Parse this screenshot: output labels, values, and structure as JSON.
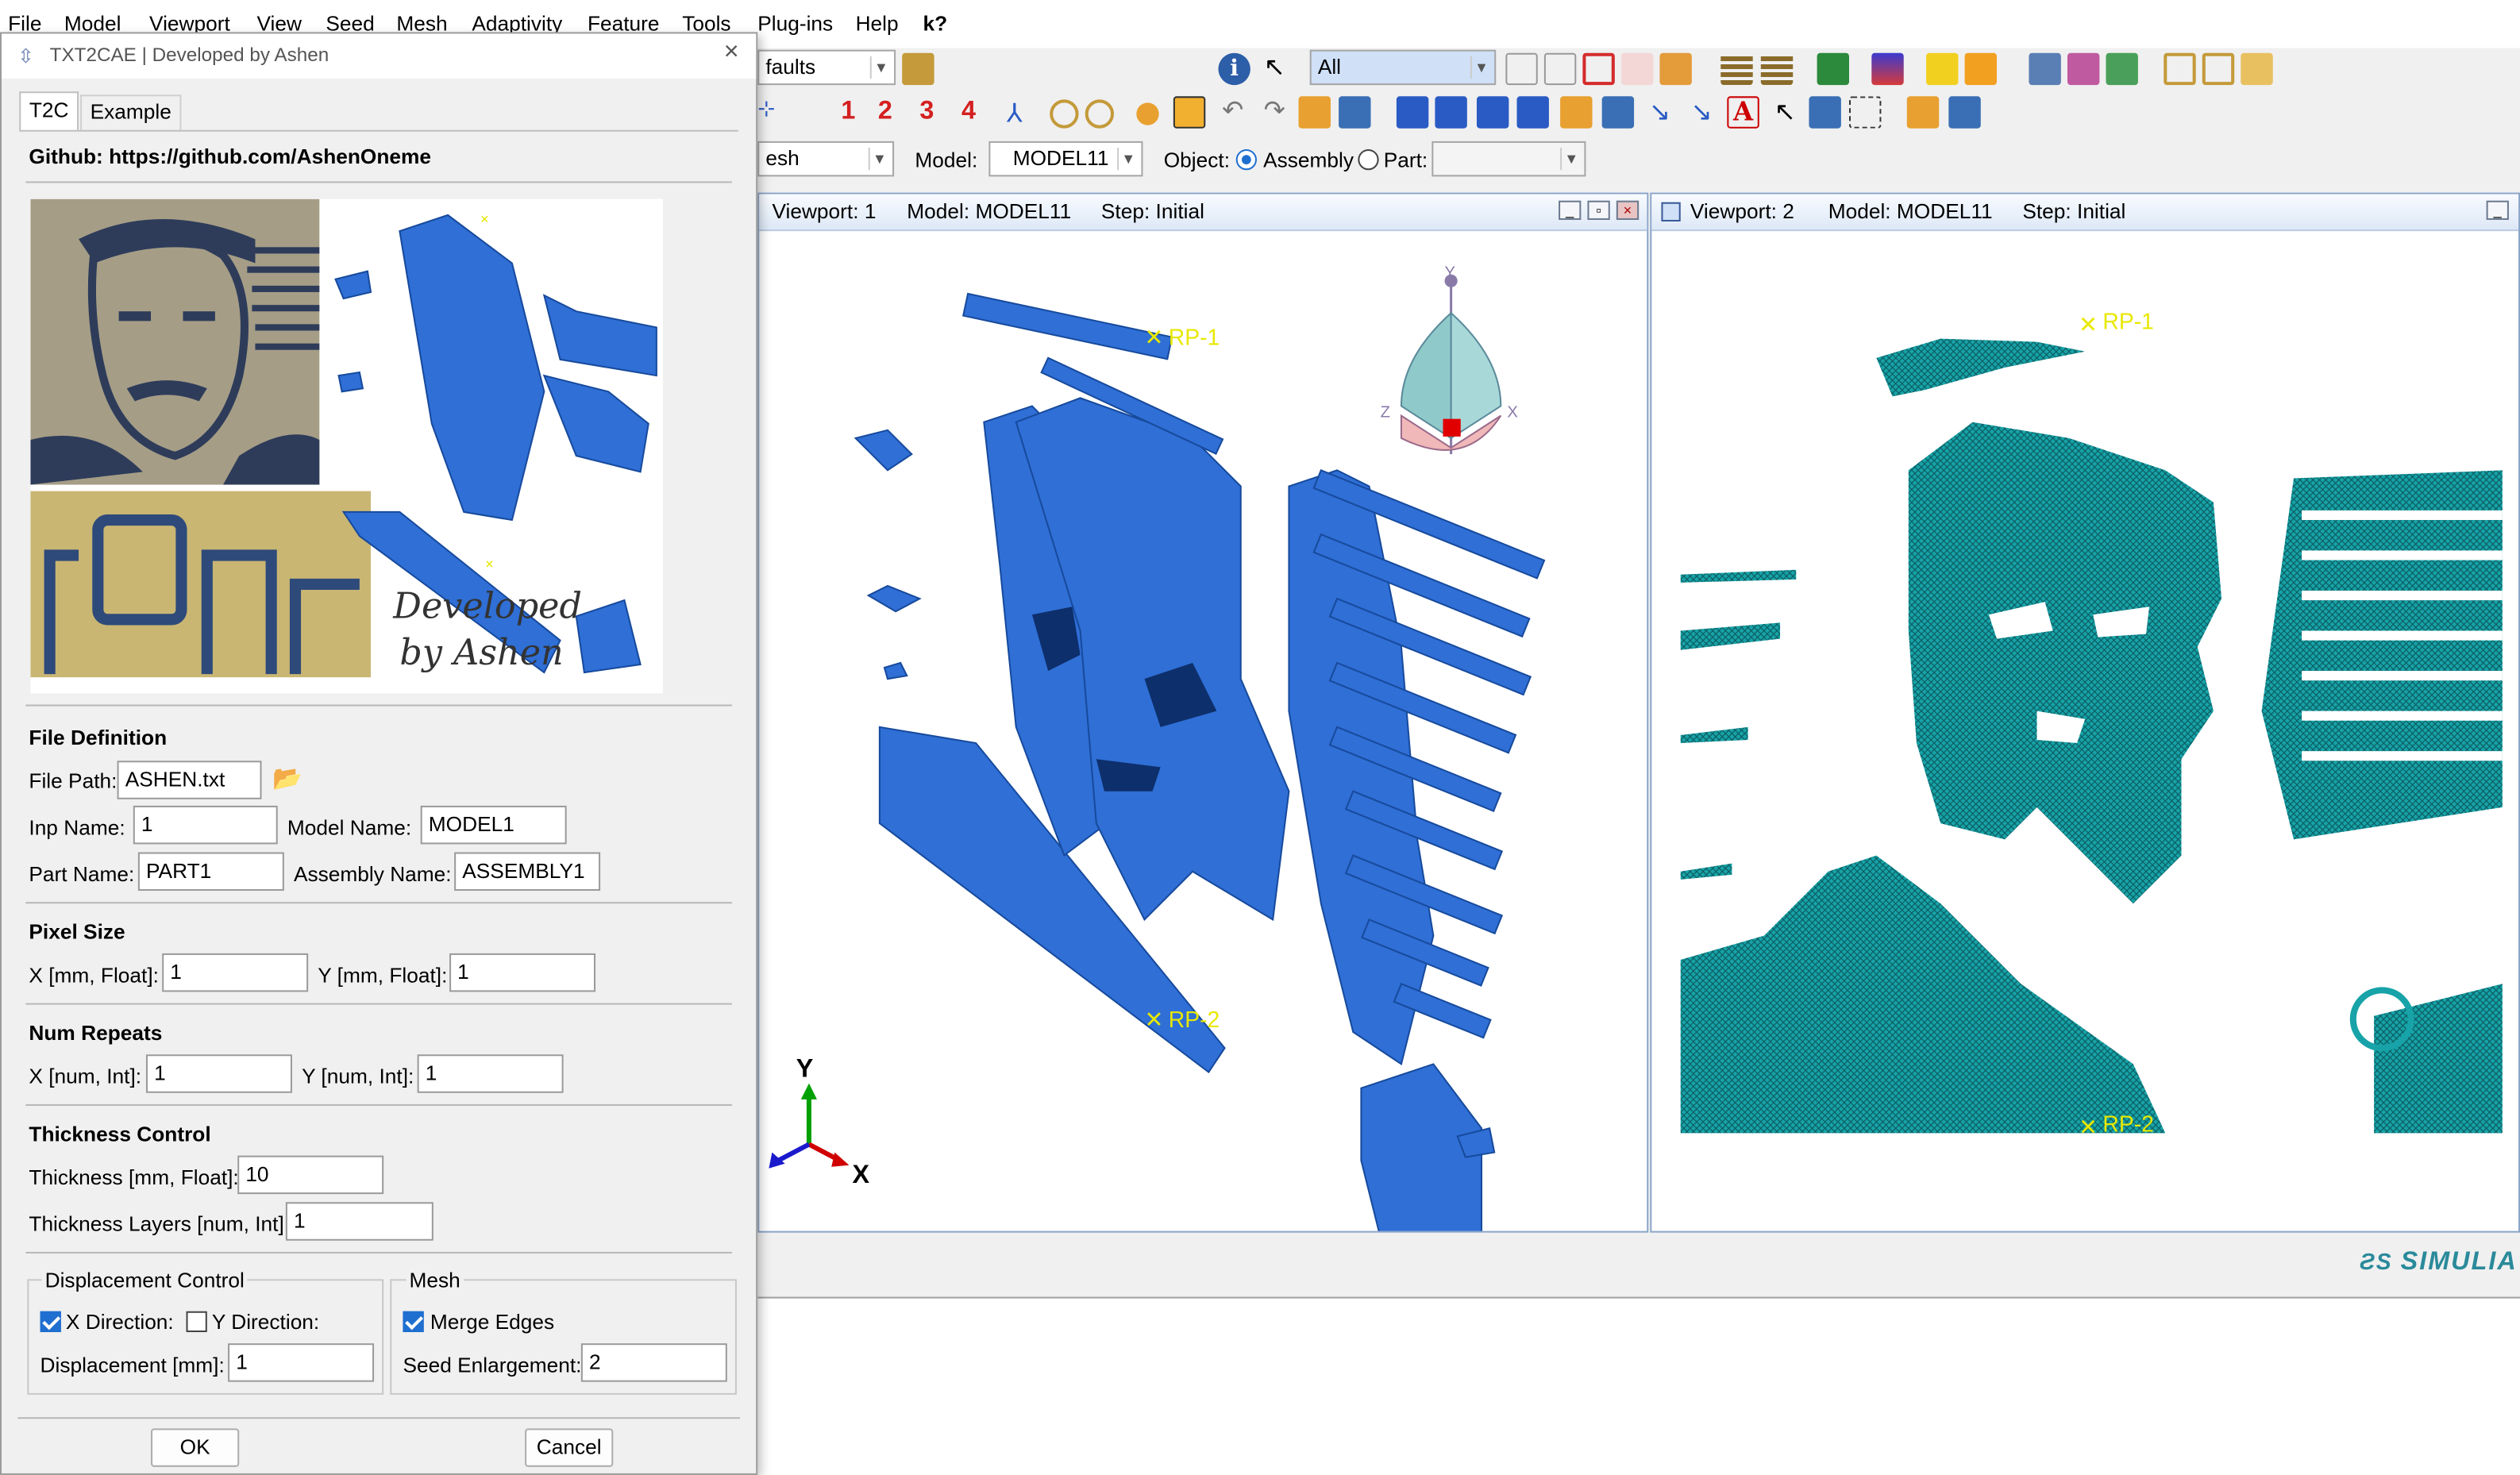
{
  "menubar": {
    "items": [
      "File",
      "Model",
      "Viewport",
      "View",
      "Seed",
      "Mesh",
      "Adaptivity",
      "Feature",
      "Tools",
      "Plug-ins",
      "Help"
    ],
    "help_cursor": "k?"
  },
  "toolbar": {
    "defaults_combo": "faults",
    "selection_combo": "All",
    "view_numbers": [
      "1",
      "2",
      "3",
      "4"
    ],
    "module_combo": "esh",
    "model_label": "Model:",
    "model_combo": "MODEL11",
    "object_label": "Object:",
    "assembly_label": "Assembly",
    "part_label": "Part:"
  },
  "viewport1": {
    "title": "Viewport: 1",
    "model": "Model: MODEL11",
    "step": "Step: Initial",
    "rp1": "RP-1",
    "rp2": "RP-2",
    "triad_y": "Y",
    "triad_x": "X",
    "view_y": "Y",
    "view_z": "Z",
    "view_x": "X"
  },
  "viewport2": {
    "title": "Viewport: 2",
    "model": "Model: MODEL11",
    "step": "Step: Initial",
    "rp1": "RP-1",
    "rp2": "RP-2"
  },
  "brand": "SIMULIA",
  "dialog": {
    "title": "TXT2CAE | Developed by Ashen",
    "tabs": [
      "T2C",
      "Example"
    ],
    "github": "Github: https://github.com/AshenOneme",
    "banner_line1": "Developed",
    "banner_line2": "by Ashen",
    "file_definition": {
      "title": "File Definition",
      "file_path_label": "File Path:",
      "file_path": "ASHEN.txt",
      "inp_name_label": "Inp Name:",
      "inp_name": "1",
      "model_name_label": "Model Name:",
      "model_name": "MODEL1",
      "part_name_label": "Part Name:",
      "part_name": "PART1",
      "assembly_name_label": "Assembly Name:",
      "assembly_name": "ASSEMBLY1"
    },
    "pixel_size": {
      "title": "Pixel Size",
      "x_label": "X [mm, Float]:",
      "x": "1",
      "y_label": "Y [mm, Float]:",
      "y": "1"
    },
    "num_repeats": {
      "title": "Num Repeats",
      "x_label": "X [num, Int]:",
      "x": "1",
      "y_label": "Y [num, Int]:",
      "y": "1"
    },
    "thickness": {
      "title": "Thickness Control",
      "thickness_label": "Thickness [mm, Float]:",
      "thickness": "10",
      "layers_label": "Thickness Layers [num, Int]:",
      "layers": "1"
    },
    "displacement": {
      "title": "Displacement Control",
      "x_dir_label": "X Direction:",
      "x_dir_checked": true,
      "y_dir_label": "Y Direction:",
      "y_dir_checked": false,
      "disp_label": "Displacement [mm]:",
      "disp": "1"
    },
    "mesh": {
      "title": "Mesh",
      "merge_label": "Merge Edges",
      "merge_checked": true,
      "seed_label": "Seed Enlargement:",
      "seed": "2"
    },
    "ok": "OK",
    "cancel": "Cancel"
  },
  "colors": {
    "part_blue": "#2f6fd6",
    "mesh_teal": "#17a3a8",
    "rp_yellow": "#e8e800",
    "accent": "#1f6fd0"
  }
}
